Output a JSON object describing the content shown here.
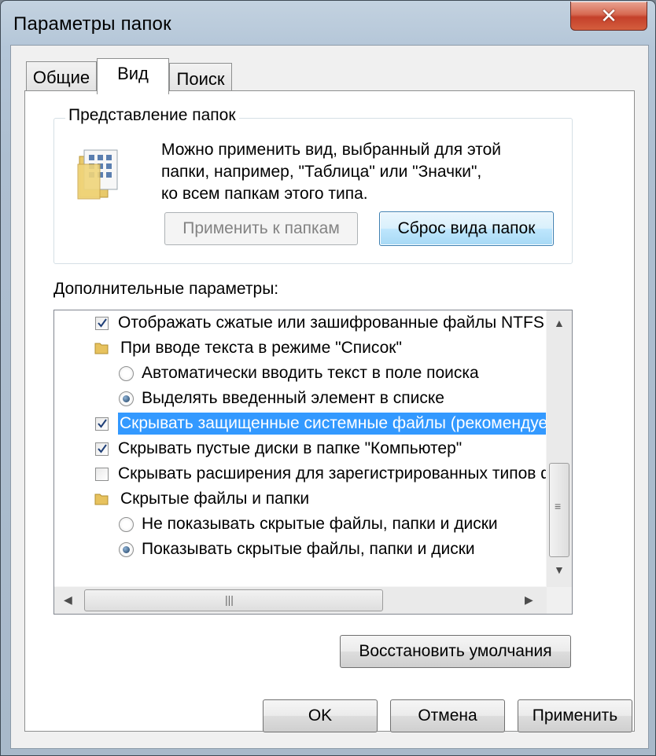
{
  "window": {
    "title": "Параметры папок",
    "close_glyph": "✕"
  },
  "tabs": [
    {
      "label": "Общие",
      "active": false
    },
    {
      "label": "Вид",
      "active": true
    },
    {
      "label": "Поиск",
      "active": false
    }
  ],
  "folder_views": {
    "group_title": "Представление папок",
    "description_lines": [
      "Можно применить вид, выбранный для этой",
      "папки, например, \"Таблица\" или \"Значки\",",
      "ко всем папкам этого типа."
    ],
    "apply_button": "Применить к папкам",
    "reset_button": "Сброс вида папок"
  },
  "advanced": {
    "label": "Дополнительные параметры:",
    "items": [
      {
        "type": "checkbox",
        "checked": true,
        "text": "Отображать сжатые или зашифрованные файлы NTFS"
      },
      {
        "type": "folder",
        "text": "При вводе текста в режиме \"Список\""
      },
      {
        "type": "radio",
        "checked": false,
        "text": "Автоматически вводить текст в поле поиска"
      },
      {
        "type": "radio",
        "checked": true,
        "text": "Выделять введенный элемент в списке"
      },
      {
        "type": "checkbox",
        "checked": true,
        "selected": true,
        "text": "Скрывать защищенные системные файлы (рекомендуется)"
      },
      {
        "type": "checkbox",
        "checked": true,
        "text": "Скрывать пустые диски в папке \"Компьютер\""
      },
      {
        "type": "checkbox",
        "checked": false,
        "text": "Скрывать расширения для зарегистрированных типов файлов"
      },
      {
        "type": "folder",
        "text": "Скрытые файлы и папки"
      },
      {
        "type": "radio",
        "checked": false,
        "text": "Не показывать скрытые файлы, папки и диски"
      },
      {
        "type": "radio",
        "checked": true,
        "text": "Показывать скрытые файлы, папки и диски"
      }
    ]
  },
  "restore_button": "Восстановить умолчания",
  "footer": {
    "ok": "OK",
    "cancel": "Отмена",
    "apply": "Применить"
  }
}
